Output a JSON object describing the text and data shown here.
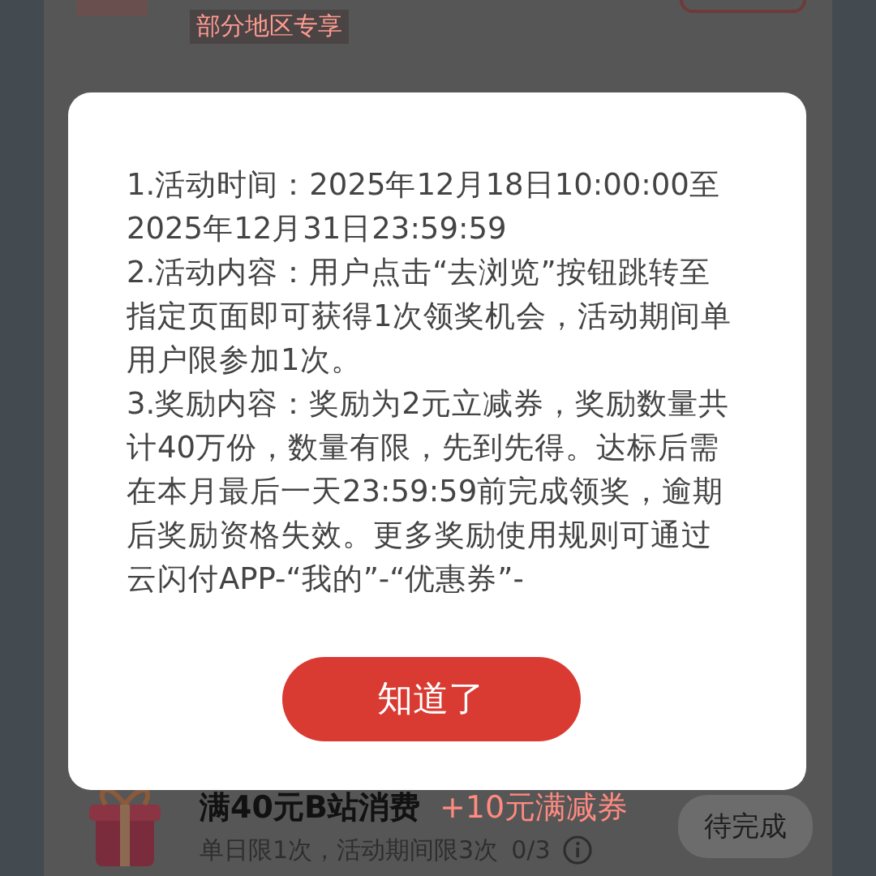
{
  "top_task": {
    "tag": "部分地区专享"
  },
  "bottom_task": {
    "title": "满40元B站消费",
    "reward": "+10元满减券",
    "limit": "单日限1次，活动期间限3次",
    "progress": "0/3",
    "button": "待完成"
  },
  "dialog": {
    "paragraphs": [
      "1.活动时间：2025年12月18日10:00:00至2025年12月31日23:59:59",
      "2.活动内容：用户点击“去浏览”按钮跳转至指定页面即可获得1次领奖机会，活动期间单用户限参加1次。",
      "3.奖励内容：奖励为2元立减券，奖励数量共计40万份，数量有限，先到先得。达标后需在本月最后一天23:59:59前完成领奖，逾期后奖励资格失效。更多奖励使用规则可通过云闪付APP-“我的”-“优惠券”-"
    ],
    "button": "知道了"
  }
}
